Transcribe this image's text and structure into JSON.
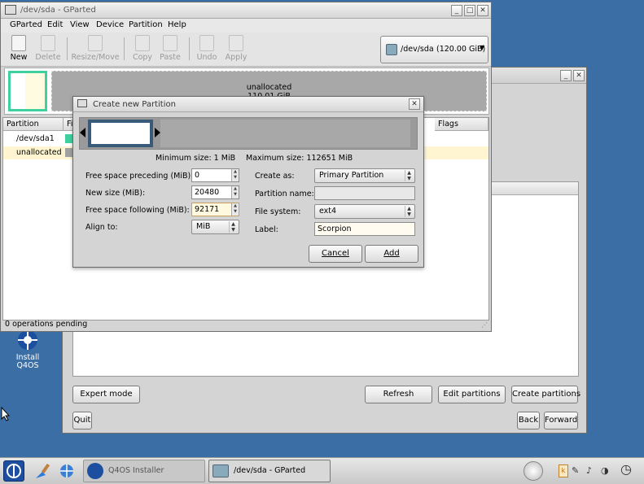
{
  "installer": {
    "buttons": {
      "expert_mode": "Expert mode",
      "refresh": "Refresh",
      "edit_partitions": "Edit partitions",
      "create_partitions": "Create partitions",
      "quit": "Quit",
      "back": "Back",
      "forward": "Forward"
    }
  },
  "desktop": {
    "install_icon_label": "Install\nQ4OS"
  },
  "gparted": {
    "title": "/dev/sda - GParted",
    "menu": [
      "GParted",
      "Edit",
      "View",
      "Device",
      "Partition",
      "Help"
    ],
    "toolbar": {
      "new": "New",
      "delete": "Delete",
      "resize_move": "Resize/Move",
      "copy": "Copy",
      "paste": "Paste",
      "undo": "Undo",
      "apply": "Apply"
    },
    "device_selector": {
      "device": "/dev/sda",
      "size": "(120.00 GiB)"
    },
    "disk_map": {
      "unallocated_label": "unallocated",
      "unallocated_size": "110.01 GiB"
    },
    "columns": {
      "partition": "Partition",
      "fi": "Fi",
      "flags": "Flags"
    },
    "rows": [
      {
        "partition": "/dev/sda1",
        "color": "#40d0a0"
      },
      {
        "partition": "unallocated",
        "color": "#a0a0a0",
        "selected": true
      }
    ],
    "status": "0 operations pending"
  },
  "dialog": {
    "title": "Create new Partition",
    "min_size": "Minimum size: 1 MiB",
    "max_size": "Maximum size: 112651 MiB",
    "fields": {
      "free_preceding": {
        "label": "Free space preceding (MiB):",
        "value": "0"
      },
      "new_size": {
        "label": "New size (MiB):",
        "value": "20480"
      },
      "free_following": {
        "label": "Free space following (MiB):",
        "value": "92171"
      },
      "align_to": {
        "label": "Align to:",
        "value": "MiB"
      },
      "create_as": {
        "label": "Create as:",
        "value": "Primary Partition"
      },
      "partition_name": {
        "label": "Partition name:",
        "value": ""
      },
      "file_system": {
        "label": "File system:",
        "value": "ext4"
      },
      "label": {
        "label": "Label:",
        "value": "Scorpion"
      }
    },
    "buttons": {
      "cancel": "Cancel",
      "add": "Add"
    }
  },
  "taskbar": {
    "tasks": [
      {
        "label": "Q4OS Installer"
      },
      {
        "label": "/dev/sda - GParted",
        "active": true
      }
    ]
  },
  "colors": {
    "desktop": "#3a6ea5",
    "partition_frame": "#3a5a7a",
    "ext4_green": "#40d0a0",
    "selected_row": "#fff5d0"
  }
}
